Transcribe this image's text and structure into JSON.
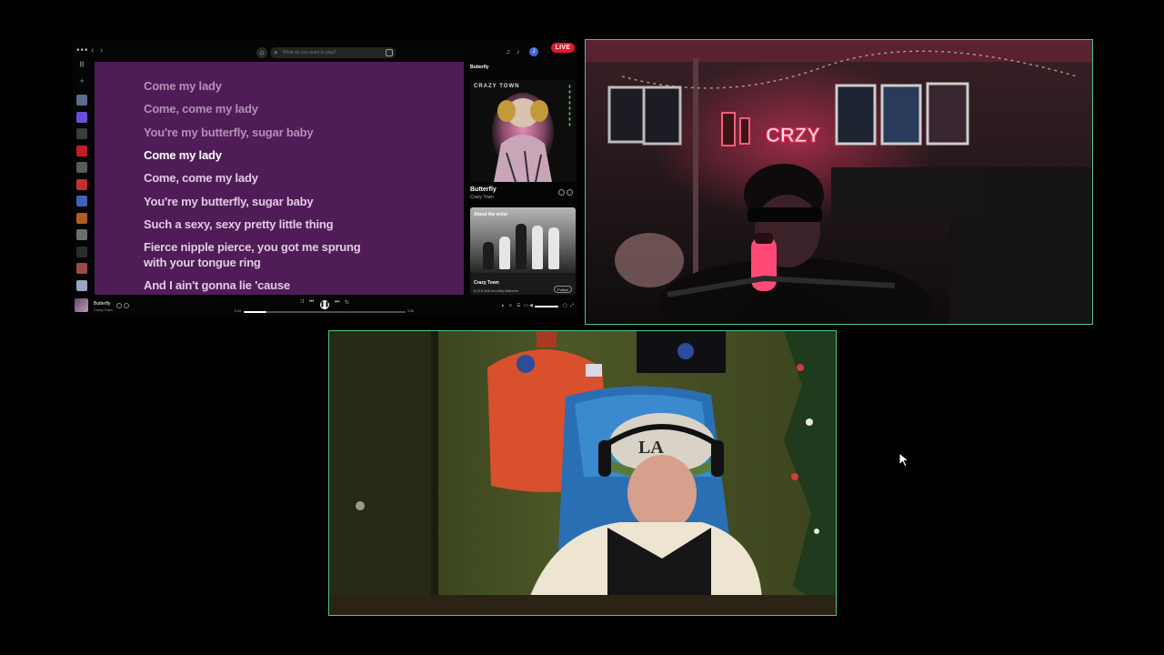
{
  "stream": {
    "live_badge": "LIVE"
  },
  "player": {
    "search_placeholder": "What do you want to play?",
    "profile_initial": "J",
    "lyrics": [
      {
        "text": "Come my lady",
        "state": "past"
      },
      {
        "text": "Come, come my lady",
        "state": "past"
      },
      {
        "text": "You're my butterfly, sugar baby",
        "state": "past"
      },
      {
        "text": "Come my lady",
        "state": "current"
      },
      {
        "text": "Come, come my lady",
        "state": "future"
      },
      {
        "text": "You're my butterfly, sugar baby",
        "state": "future"
      },
      {
        "text": "Such a sexy, sexy pretty little thing",
        "state": "future"
      },
      {
        "text": "Fierce nipple pierce, you got me sprung with your tongue ring",
        "state": "future"
      },
      {
        "text": "And I ain't gonna lie 'cause",
        "state": "future"
      }
    ],
    "right_panel": {
      "header": "Butterfly",
      "cover_text": "CRAZY TOWN",
      "song_title": "Butterfly",
      "artist": "Crazy Town",
      "about_label": "About the artist",
      "about_artist": "Crazy Town",
      "monthly_listeners": "6,376,368 monthly listeners",
      "follow_label": "Follow"
    },
    "now_playing": {
      "title": "Butterfly",
      "artist": "Crazy Town",
      "elapsed": "0:34",
      "duration": "3:36",
      "progress": 0.14
    },
    "sidebar_thumb_colors": [
      "#5e6a8a",
      "#6a4fd8",
      "#3c3c3c",
      "#c11d28",
      "#5a5a5a",
      "#c43030",
      "#3f62b8",
      "#b45a28",
      "#6e6e6e",
      "#2c2c2c",
      "#a04848",
      "#9aa3c0"
    ]
  },
  "webcams": {
    "cam1_label": "",
    "cam2_label": ""
  }
}
